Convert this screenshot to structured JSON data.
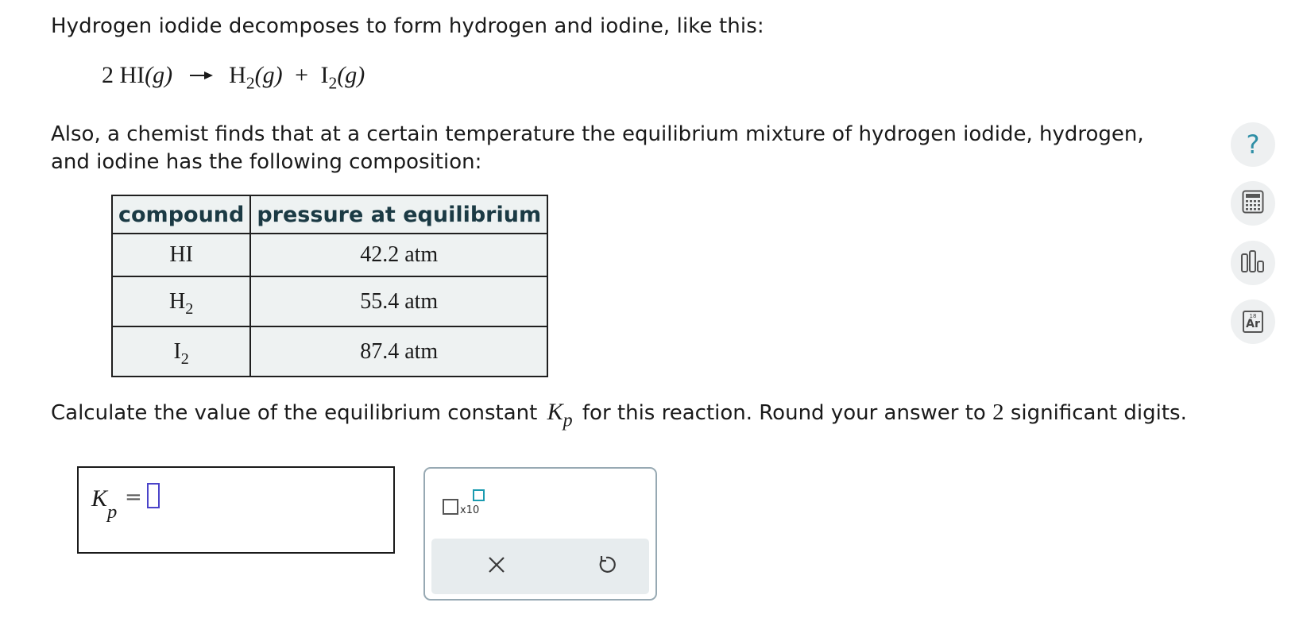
{
  "intro": "Hydrogen iodide decomposes to form hydrogen and iodine, like this:",
  "equation": {
    "coef": "2",
    "reactant": "HI",
    "reactant_state": "(g)",
    "product1": "H",
    "product1_sub": "2",
    "product1_state": "(g)",
    "plus": "+",
    "product2": "I",
    "product2_sub": "2",
    "product2_state": "(g)"
  },
  "paragraph": "Also, a chemist finds that at a certain temperature the equilibrium mixture of hydrogen iodide, hydrogen, and iodine has the following composition:",
  "table": {
    "headers": [
      "compound",
      "pressure at equilibrium"
    ],
    "rows": [
      {
        "compound": "HI",
        "compound_sub": "",
        "pressure": "42.2 atm"
      },
      {
        "compound": "H",
        "compound_sub": "2",
        "pressure": "55.4 atm"
      },
      {
        "compound": "I",
        "compound_sub": "2",
        "pressure": "87.4 atm"
      }
    ]
  },
  "question": {
    "before": "Calculate the value of the equilibrium constant",
    "symbol": "K",
    "symbol_sub": "p",
    "middle": "for this reaction. Round your answer to",
    "digits": "2",
    "after": "significant digits."
  },
  "answer": {
    "label": "K",
    "label_sub": "p",
    "equals": "=",
    "value": ""
  },
  "tools": {
    "sci_notation": "x10",
    "clear_icon": "close-icon",
    "undo_icon": "undo-icon"
  },
  "sidebar": {
    "help": "?",
    "calculator_icon": "calculator-icon",
    "chart_icon": "bar-chart-icon",
    "periodic_number": "18",
    "periodic_symbol": "Ar"
  },
  "colors": {
    "accent": "#2f8fa6",
    "table_header_text": "#1b3a44",
    "table_bg": "#eef2f2",
    "input_cursor": "#4b44c9",
    "exponent_box": "#1b9bb0",
    "panel_border": "#97a9b3",
    "button_bar": "#e7ecee"
  }
}
